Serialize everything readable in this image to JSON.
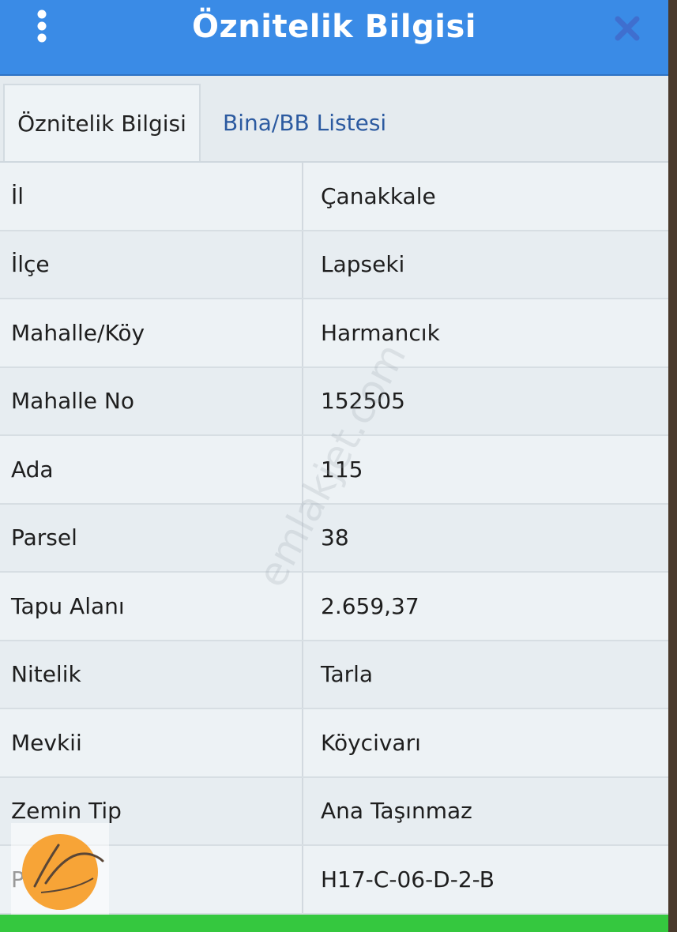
{
  "header": {
    "title": "Öznitelik Bilgisi"
  },
  "tabs": [
    {
      "label": "Öznitelik Bilgisi"
    },
    {
      "label": "Bina/BB Listesi"
    }
  ],
  "rows": [
    {
      "label": "İl",
      "value": "Çanakkale"
    },
    {
      "label": "İlçe",
      "value": "Lapseki"
    },
    {
      "label": "Mahalle/Köy",
      "value": "Harmancık"
    },
    {
      "label": "Mahalle No",
      "value": "152505"
    },
    {
      "label": "Ada",
      "value": "115"
    },
    {
      "label": "Parsel",
      "value": "38"
    },
    {
      "label": "Tapu Alanı",
      "value": "2.659,37"
    },
    {
      "label": "Nitelik",
      "value": "Tarla"
    },
    {
      "label": "Mevkii",
      "value": "Köycivarı"
    },
    {
      "label": "Zemin Tip",
      "value": "Ana Taşınmaz"
    },
    {
      "label": "Pafta",
      "value": "H17-C-06-D-2-B"
    }
  ],
  "watermark": "emlakjet.com",
  "icons": {
    "menu": "more-vertical-icon",
    "close": "close-icon"
  },
  "colors": {
    "header": "#3a8be6",
    "close": "#3f6fcf",
    "tab_link": "#2c5aa0",
    "bottom_bar": "#35c83f",
    "logo": "#f7a437"
  }
}
